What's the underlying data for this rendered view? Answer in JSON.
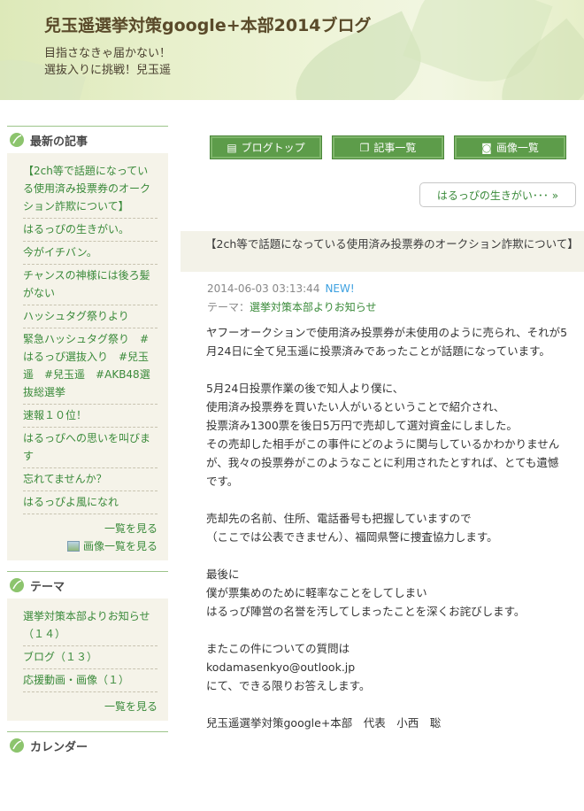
{
  "header": {
    "title": "兒玉遥選挙対策google+本部2014ブログ",
    "tagline1": "目指さなきゃ届かない！",
    "tagline2": "選抜入りに挑戦！兒玉遥"
  },
  "sidebar": {
    "recent": {
      "heading": "最新の記事",
      "items": [
        "【2ch等で話題になっている使用済み投票券のオークション詐欺について】",
        "はるっぴの生きがい。",
        "今がイチバン。",
        "チャンスの神様には後ろ髪がない",
        "ハッシュタグ祭りより",
        "緊急ハッシュタグ祭り　#はるっぴ選抜入り　#兒玉遥　#兒玉遥　#AKB48選抜総選挙",
        "速報１０位！",
        "はるっぴへの思いを叫びます",
        "忘れてませんか？",
        "はるっぴよ風になれ"
      ],
      "more": "一覧を見る",
      "image_more": "画像一覧を見る"
    },
    "theme": {
      "heading": "テーマ",
      "items": [
        "選挙対策本部よりお知らせ（１４）",
        "ブログ（１３）",
        "応援動画・画像（１）"
      ],
      "more": "一覧を見る"
    },
    "calendar": {
      "heading": "カレンダー"
    }
  },
  "nav": {
    "blog_top": "ブログトップ",
    "article_list": "記事一覧",
    "image_list": "画像一覧",
    "next_article": "はるっぴの生きがい･･･ »"
  },
  "article": {
    "title": "【2ch等で話題になっている使用済み投票券のオークション詐欺について】",
    "date": "2014-06-03 03:13:44",
    "new_badge": "NEW!",
    "theme_label": "テーマ：",
    "theme_value": "選挙対策本部よりお知らせ",
    "paragraphs": [
      [
        "ヤフーオークションで使用済み投票券が未使用のように売られ、それが5月24日に全て兒玉遥に投票済みであったことが話題になっています。"
      ],
      [
        "5月24日投票作業の後で知人より僕に、",
        "使用済み投票券を買いたい人がいるということで紹介され、",
        "投票済み1300票を後日5万円で売却して選対資金にしました。",
        "その売却した相手がこの事件にどのように関与しているかわかりませんが、我々の投票券がこのようなことに利用されたとすれば、とても遺憾です。"
      ],
      [
        "売却先の名前、住所、電話番号も把握していますので",
        "（ここでは公表できません）、福岡県警に捜査協力します。"
      ],
      [
        "最後に",
        "僕が票集めのために軽率なことをしてしまい",
        "はるっぴ陣営の名誉を汚してしまったことを深くお詫びします。"
      ],
      [
        "またこの件についての質問は",
        "kodamasenkyo@outlook.jp",
        "にて、できる限りお答えします。"
      ],
      [
        "兒玉遥選挙対策google+本部　代表　小西　聡"
      ]
    ]
  },
  "colors": {
    "accent_green": "#5d9c4a",
    "link_green": "#3a8a3a",
    "new_badge": "#3ca0e0"
  }
}
